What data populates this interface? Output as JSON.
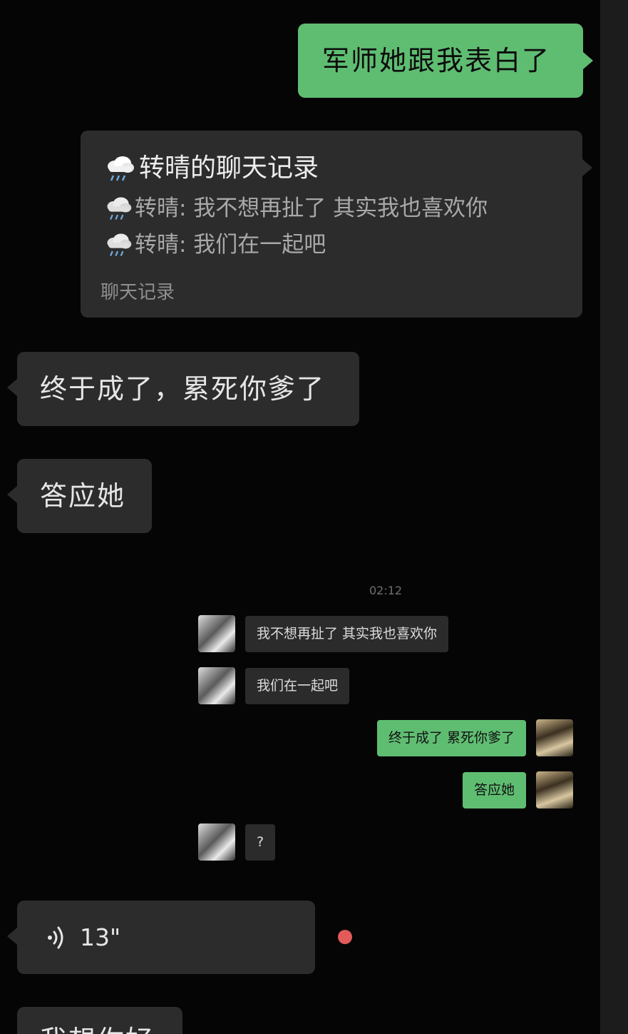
{
  "messages": {
    "confession_report": "军师她跟我表白了",
    "reply_finally": "终于成了，累死你爹了",
    "reply_accept": "答应她",
    "partial_last": "我想你好"
  },
  "chat_record_card": {
    "title": "转晴的聊天记录",
    "lines": [
      "转晴: 我不想再扯了 其实我也喜欢你",
      "转晴: 我们在一起吧"
    ],
    "footer": "聊天记录"
  },
  "screenshot": {
    "time": "02:12",
    "rows": [
      {
        "side": "in",
        "text": "我不想再扯了 其实我也喜欢你"
      },
      {
        "side": "in",
        "text": "我们在一起吧"
      },
      {
        "side": "out",
        "text": "终于成了 累死你爹了"
      },
      {
        "side": "out",
        "text": "答应她"
      },
      {
        "side": "in",
        "text": "?"
      }
    ]
  },
  "voice_message": {
    "duration": "13\""
  },
  "colors": {
    "background": "#050505",
    "bubble_in": "#2c2c2c",
    "bubble_out": "#5fbd72",
    "unread_dot": "#e25a5a"
  },
  "icons": [
    "rain-cloud-icon",
    "voice-wave-icon"
  ]
}
